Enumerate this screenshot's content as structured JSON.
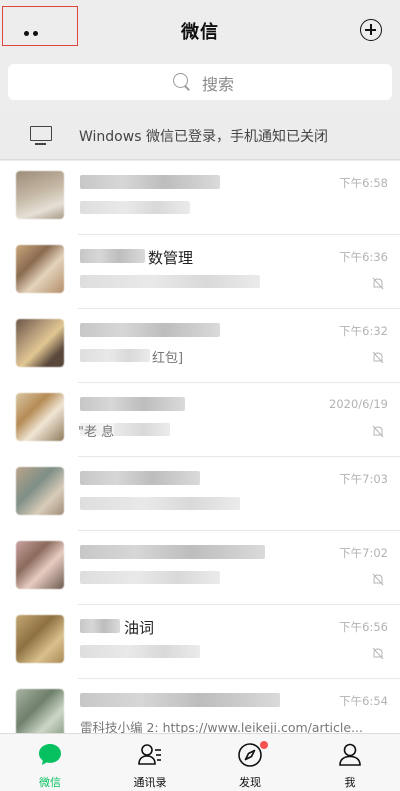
{
  "header": {
    "title": "微信"
  },
  "search": {
    "placeholder": "搜索"
  },
  "login_bar": {
    "text": "Windows 微信已登录，手机通知已关闭"
  },
  "chats": [
    {
      "time": "下午6:58",
      "muted": false,
      "name_fragment": "",
      "msg_fragment": ""
    },
    {
      "time": "下午6:36",
      "muted": true,
      "name_fragment": "数管理",
      "msg_fragment": ""
    },
    {
      "time": "下午6:32",
      "muted": true,
      "name_fragment": "",
      "msg_fragment": "红包]"
    },
    {
      "time": "2020/6/19",
      "muted": true,
      "name_fragment": "",
      "msg_fragment": "\"老 息"
    },
    {
      "time": "下午7:03",
      "muted": false,
      "name_fragment": "",
      "msg_fragment": ""
    },
    {
      "time": "下午7:02",
      "muted": true,
      "name_fragment": "",
      "msg_fragment": ""
    },
    {
      "time": "下午6:56",
      "muted": true,
      "name_fragment": "油词",
      "msg_fragment": ""
    },
    {
      "time": "下午6:54",
      "muted": false,
      "name_fragment": "",
      "msg_fragment": "雷科技小编 2: https://www.leikeji.com/article..."
    }
  ],
  "tabs": [
    {
      "label": "微信",
      "icon": "chat-bubble-icon",
      "active": true
    },
    {
      "label": "通讯录",
      "icon": "contacts-icon",
      "active": false
    },
    {
      "label": "发现",
      "icon": "compass-icon",
      "active": false,
      "badge": true
    },
    {
      "label": "我",
      "icon": "person-icon",
      "active": false
    }
  ],
  "colors": {
    "accent": "#07c160",
    "badge": "#fa5151",
    "highlight_box": "#e0463c"
  }
}
